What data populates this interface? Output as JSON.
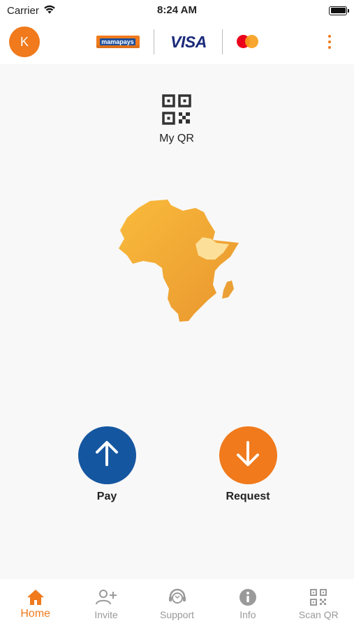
{
  "status_bar": {
    "carrier": "Carrier",
    "time": "8:24 AM"
  },
  "header": {
    "avatar_initial": "K",
    "brand_logo_text": "mamapays",
    "card_network_1": "VISA",
    "card_network_2_icon": "mastercard-logo",
    "menu_icon": "more-vertical-icon"
  },
  "main": {
    "my_qr_label": "My QR",
    "map_icon": "africa-map-ethiopia-highlighted",
    "pay_label": "Pay",
    "request_label": "Request"
  },
  "tabs": [
    {
      "label": "Home",
      "icon": "home-icon",
      "active": true
    },
    {
      "label": "Invite",
      "icon": "add-user-icon",
      "active": false
    },
    {
      "label": "Support",
      "icon": "support-icon",
      "active": false
    },
    {
      "label": "Info",
      "icon": "info-icon",
      "active": false
    },
    {
      "label": "Scan QR",
      "icon": "scan-qr-icon",
      "active": false
    }
  ],
  "colors": {
    "accent": "#f07a1c",
    "pay_blue": "#1556a0",
    "tab_inactive": "#999999",
    "background": "#f8f8f8"
  }
}
